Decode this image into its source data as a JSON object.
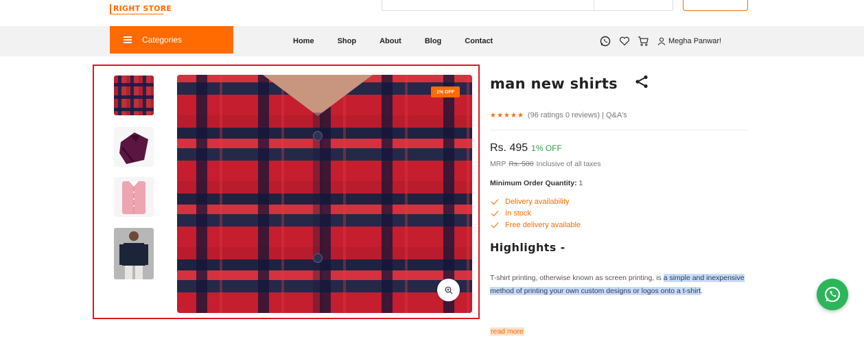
{
  "header": {
    "logo_text": "RIGHT STORE"
  },
  "nav": {
    "categories_label": "Categories",
    "links": [
      "Home",
      "Shop",
      "About",
      "Blog",
      "Contact"
    ],
    "user_name": "Megha Panwar!"
  },
  "gallery": {
    "badge": "1% OFF",
    "thumbnails": [
      "red-navy-check-shirt",
      "purple-folded-shirt",
      "pink-folded-shirt",
      "navy-shirt-model"
    ]
  },
  "product": {
    "title": "man new shirts",
    "rating_text": "(96 ratings 0 reviews) | Q&A's",
    "stars": 5,
    "price": "Rs. 495",
    "price_off": "1% OFF",
    "mrp_label": "MRP",
    "mrp_value": "Rs. 500",
    "tax_note": "Inclusive of all taxes",
    "moq_label": "Minimum Order Quantity:",
    "moq_value": "1",
    "features": [
      "Delivery availability",
      "In stock",
      "Free delivery available"
    ],
    "highlights_title": "Highlights -",
    "desc_plain": "T-shirt printing, otherwise known as screen printing, is ",
    "desc_highlight_1": "a simple and inexpensive method of printing your own custom designs or logos onto a t-shirt",
    "desc_end": ".",
    "read_more": "read more"
  },
  "colors": {
    "accent": "#ff6b00",
    "green": "#2e9e44",
    "selection": "#e0161f",
    "whatsapp": "#2bb65a"
  }
}
